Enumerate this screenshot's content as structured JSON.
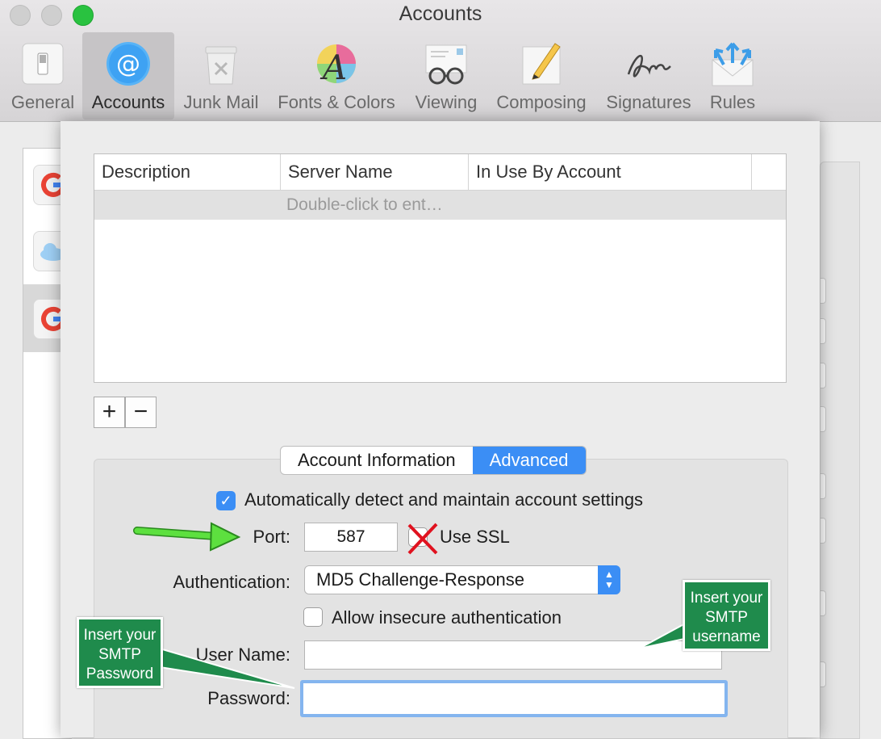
{
  "window": {
    "title": "Accounts"
  },
  "toolbar": {
    "items": [
      {
        "label": "General",
        "icon": "general-switch-icon"
      },
      {
        "label": "Accounts",
        "icon": "at-sign-icon",
        "selected": true
      },
      {
        "label": "Junk Mail",
        "icon": "junk-mail-icon"
      },
      {
        "label": "Fonts & Colors",
        "icon": "fonts-colors-icon"
      },
      {
        "label": "Viewing",
        "icon": "viewing-glasses-icon"
      },
      {
        "label": "Composing",
        "icon": "composing-pencil-icon"
      },
      {
        "label": "Signatures",
        "icon": "signature-icon"
      },
      {
        "label": "Rules",
        "icon": "rules-envelope-icon"
      }
    ]
  },
  "server_table": {
    "columns": [
      "Description",
      "Server Name",
      "In Use By Account"
    ],
    "rows": [
      {
        "description": "",
        "server_name": "Double-click to ent…",
        "in_use": ""
      }
    ]
  },
  "buttons": {
    "add": "+",
    "remove": "−"
  },
  "tabs": {
    "items": [
      "Account Information",
      "Advanced"
    ],
    "selected": "Advanced"
  },
  "form": {
    "auto_detect_label": "Automatically detect and maintain account settings",
    "auto_detect_checked": true,
    "port_label": "Port:",
    "port_value": "587",
    "use_ssl_label": "Use SSL",
    "auth_label": "Authentication:",
    "auth_value": "MD5 Challenge-Response",
    "insecure_label": "Allow insecure authentication",
    "insecure_checked": false,
    "username_label": "User Name:",
    "username_value": "",
    "password_label": "Password:",
    "password_value": ""
  },
  "annotations": {
    "username_callout": [
      "Insert your",
      "SMTP",
      "username"
    ],
    "password_callout": [
      "Insert your",
      "SMTP",
      "Password"
    ]
  },
  "colors": {
    "accent": "#3b8ef5",
    "callout": "#1f8b4c",
    "arrow": "#5de03f",
    "cross": "#e0121f"
  }
}
